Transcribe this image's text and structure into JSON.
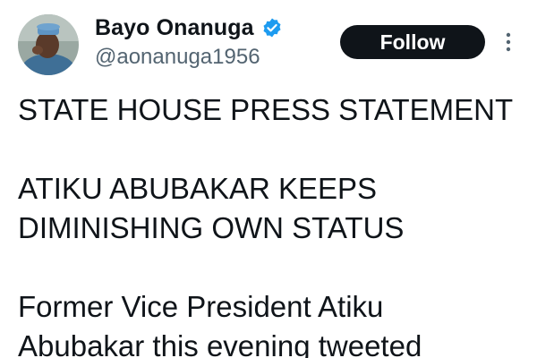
{
  "author": {
    "display_name": "Bayo Onanuga",
    "handle": "@aonanuga1956",
    "verified": true
  },
  "follow_label": "Follow",
  "tweet": {
    "lines": [
      "STATE HOUSE PRESS STATEMENT",
      "",
      "ATIKU ABUBAKAR KEEPS",
      "DIMINISHING OWN STATUS",
      "",
      "Former Vice President Atiku",
      "Abubakar this evening tweeted"
    ]
  },
  "colors": {
    "text": "#0f1419",
    "secondary": "#536471",
    "verified": "#1d9bf0",
    "button": "#0f1419"
  },
  "icons": {
    "verified": "verified-badge-icon",
    "more": "more-options-icon"
  }
}
